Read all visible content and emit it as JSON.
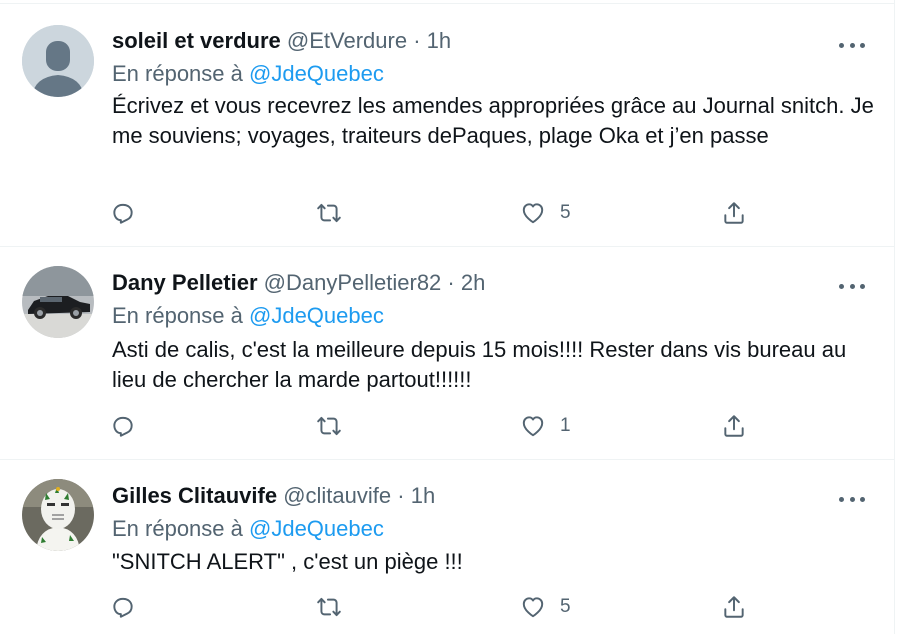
{
  "colors": {
    "accent": "#1d9bf0",
    "muted": "#536471",
    "text": "#0f1419",
    "divider": "#eff3f4"
  },
  "tweets": [
    {
      "name": "soleil et verdure",
      "handle": "@EtVerdure",
      "separator": "·",
      "time": "1h",
      "reply_prefix": "En réponse à",
      "reply_mention": "@JdeQuebec",
      "text": "Écrivez et vous recevrez les amendes appropriées grâce au Journal snitch. Je me souviens; voyages, traiteurs dePaques, plage Oka et j’en passe",
      "avatar": "default-avatar-icon",
      "likes": "5"
    },
    {
      "name": "Dany Pelletier",
      "handle": "@DanyPelletier82",
      "separator": "·",
      "time": "2h",
      "reply_prefix": "En réponse à",
      "reply_mention": "@JdeQuebec",
      "text": "Asti de calis, c'est la meilleure depuis 15 mois!!!! Rester dans vis bureau au lieu de chercher la marde partout!!!!!!",
      "avatar": "car-photo-avatar",
      "likes": "1"
    },
    {
      "name": "Gilles Clitauvife",
      "handle": "@clitauvife",
      "separator": "·",
      "time": "1h",
      "reply_prefix": "En réponse à",
      "reply_mention": "@JdeQuebec",
      "text": "\"SNITCH ALERT\" , c'est un piège !!!",
      "avatar": "goalie-mask-avatar",
      "likes": "5"
    }
  ]
}
